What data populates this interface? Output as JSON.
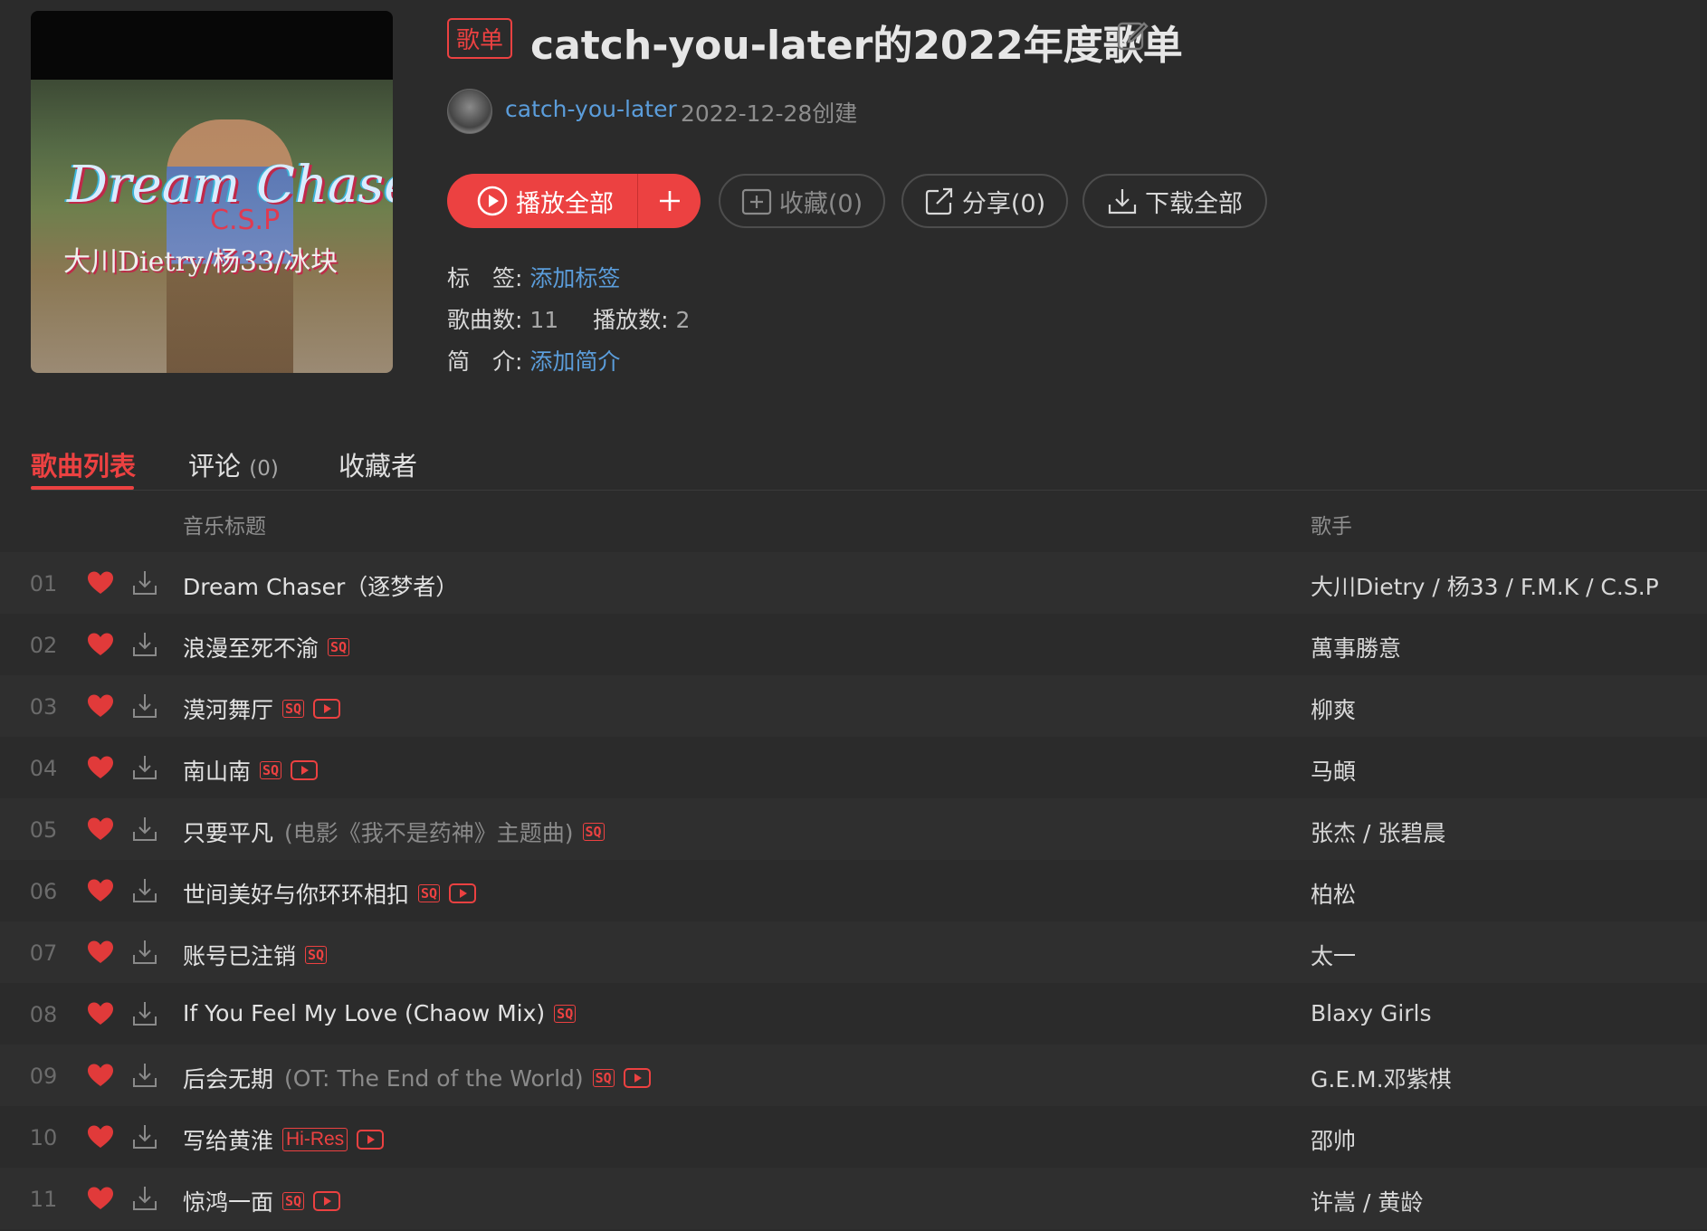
{
  "header": {
    "tag": "歌单",
    "title": "catch-you-later的2022年度歌单",
    "creator": "catch-you-later",
    "created": "2022-12-28创建"
  },
  "cover": {
    "art_title": "Dream Chaser",
    "art_sub": "C.S.P",
    "art_artists": "大川Dietry/杨33/冰块"
  },
  "actions": {
    "play_all": "播放全部",
    "favorite": "收藏(0)",
    "share": "分享(0)",
    "download_all": "下载全部"
  },
  "meta": {
    "tags_label": "标　签:",
    "tags_link": "添加标签",
    "songs_label": "歌曲数:",
    "songs_value": "11",
    "plays_label": "播放数:",
    "plays_value": "2",
    "intro_label": "简　介:",
    "intro_link": "添加简介"
  },
  "tabs": {
    "songs": "歌曲列表",
    "comments": "评论",
    "comments_count": "(0)",
    "collectors": "收藏者"
  },
  "columns": {
    "title": "音乐标题",
    "artist": "歌手"
  },
  "colors": {
    "accent": "#ec4141",
    "link": "#5b9ddb",
    "bg": "#2b2b2b"
  },
  "tracks": [
    {
      "num": "01",
      "title": "Dream Chaser（逐梦者）",
      "sub": "",
      "badge": "",
      "mv": false,
      "artist": "大川Dietry / 杨33 / F.M.K / C.S.P"
    },
    {
      "num": "02",
      "title": "浪漫至死不渝",
      "sub": "",
      "badge": "SQ",
      "mv": false,
      "artist": "萬事勝意"
    },
    {
      "num": "03",
      "title": "漠河舞厅",
      "sub": "",
      "badge": "SQ",
      "mv": true,
      "artist": "柳爽"
    },
    {
      "num": "04",
      "title": "南山南",
      "sub": "",
      "badge": "SQ",
      "mv": true,
      "artist": "马頔"
    },
    {
      "num": "05",
      "title": "只要平凡",
      "sub": "(电影《我不是药神》主题曲)",
      "badge": "SQ",
      "mv": false,
      "artist": "张杰 / 张碧晨"
    },
    {
      "num": "06",
      "title": "世间美好与你环环相扣",
      "sub": "",
      "badge": "SQ",
      "mv": true,
      "artist": "柏松"
    },
    {
      "num": "07",
      "title": "账号已注销",
      "sub": "",
      "badge": "SQ",
      "mv": false,
      "artist": "太一"
    },
    {
      "num": "08",
      "title": "If You Feel My Love (Chaow Mix)",
      "sub": "",
      "badge": "SQ",
      "mv": false,
      "artist": "Blaxy Girls"
    },
    {
      "num": "09",
      "title": "后会无期",
      "sub": "(OT: The End of the World)",
      "badge": "SQ",
      "mv": true,
      "artist": "G.E.M.邓紫棋"
    },
    {
      "num": "10",
      "title": "写给黄淮",
      "sub": "",
      "badge": "Hi-Res",
      "mv": true,
      "artist": "邵帅"
    },
    {
      "num": "11",
      "title": "惊鸿一面",
      "sub": "",
      "badge": "SQ",
      "mv": true,
      "artist": "许嵩 / 黄龄"
    }
  ]
}
